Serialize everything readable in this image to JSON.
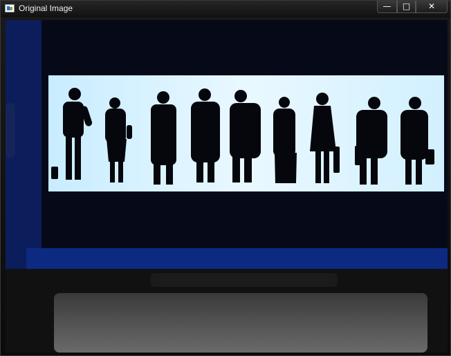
{
  "window": {
    "title": "Original Image",
    "controls": {
      "minimize": "—",
      "maximize": "□",
      "close": "✕"
    }
  },
  "icons": [
    "app-icon",
    "minimize-icon",
    "maximize-icon",
    "close-icon"
  ],
  "colors": {
    "screen_backlight": "#d9f2ff",
    "silhouette": "#05070d",
    "device_bezel": "#0d2a7a",
    "frame_dark": "#05070f"
  }
}
